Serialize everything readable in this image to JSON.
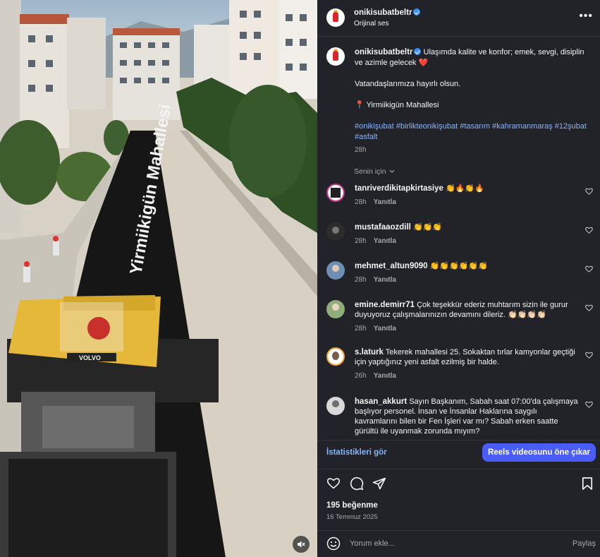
{
  "video": {
    "road_text": "Yirmiikigün Mahallesi",
    "machine_brand": "VOLVO"
  },
  "header": {
    "username": "onikisubatbeltr",
    "audio": "Orijinal ses"
  },
  "caption": {
    "username": "onikisubatbeltr",
    "text": "Ulaşımda kalite ve konfor; emek, sevgi, disiplin ve azimle gelecek",
    "heart_emoji": "❤️",
    "line2": "Vatandaşlarımıza hayırlı olsun.",
    "location_pin": "📍",
    "location": "Yirmiikigün Mahallesi",
    "hashtags": "#onikişubat #birlikteonikişubat #tasarım #kahramanmaraş #12şubat #asfalt",
    "time": "28h"
  },
  "sort_label": "Senin için",
  "comments": [
    {
      "username": "tanriverdikitapkirtasiye",
      "text": "👏🔥👏🔥",
      "time": "28h",
      "reply": "Yanıtla"
    },
    {
      "username": "mustafaaozdill",
      "text": "👏👏👏",
      "time": "28h",
      "reply": "Yanıtla"
    },
    {
      "username": "mehmet_altun9090",
      "text": "👏👏👏👏👏👏",
      "time": "28h",
      "reply": "Yanıtla"
    },
    {
      "username": "emine.demirr71",
      "text": "Çok teşekkür ederiz muhtarım sizin ile gurur duyuyoruz çalışmalarınızın devamını dileriz. 👏🏻👏🏻👏🏻👏🏻",
      "time": "28h",
      "reply": "Yanıtla"
    },
    {
      "username": "s.laturk",
      "text": "Tekerek mahallesi 25. Sokaktan tırlar kamyonlar geçtiği için yaptığınız yeni asfalt ezilmiş bir halde.",
      "time": "26h",
      "reply": "Yanıtla"
    },
    {
      "username": "hasan_akkurt",
      "text": "Sayın Başkanım, Sabah saat 07:00'da çalışmaya başlıyor personel. İnsan ve İnsanlar Haklarına saygılı kavramlarını bilen bir Fen İşleri var mı? Sabah erken saatte gürültü ile uyanmak zorunda mıyım?",
      "time": "",
      "reply": ""
    }
  ],
  "insights_link": "İstatistikleri gör",
  "boost_button": "Reels videosunu öne çıkar",
  "likes": "195 beğenme",
  "date": "16 Temmuz 2025",
  "compose": {
    "placeholder": "Yorum ekle...",
    "post": "Paylaş"
  },
  "colors": {
    "panel_bg": "#212328",
    "link": "#8ab4f8",
    "primary_button": "#4a5df9",
    "verified": "#3b91f7"
  }
}
